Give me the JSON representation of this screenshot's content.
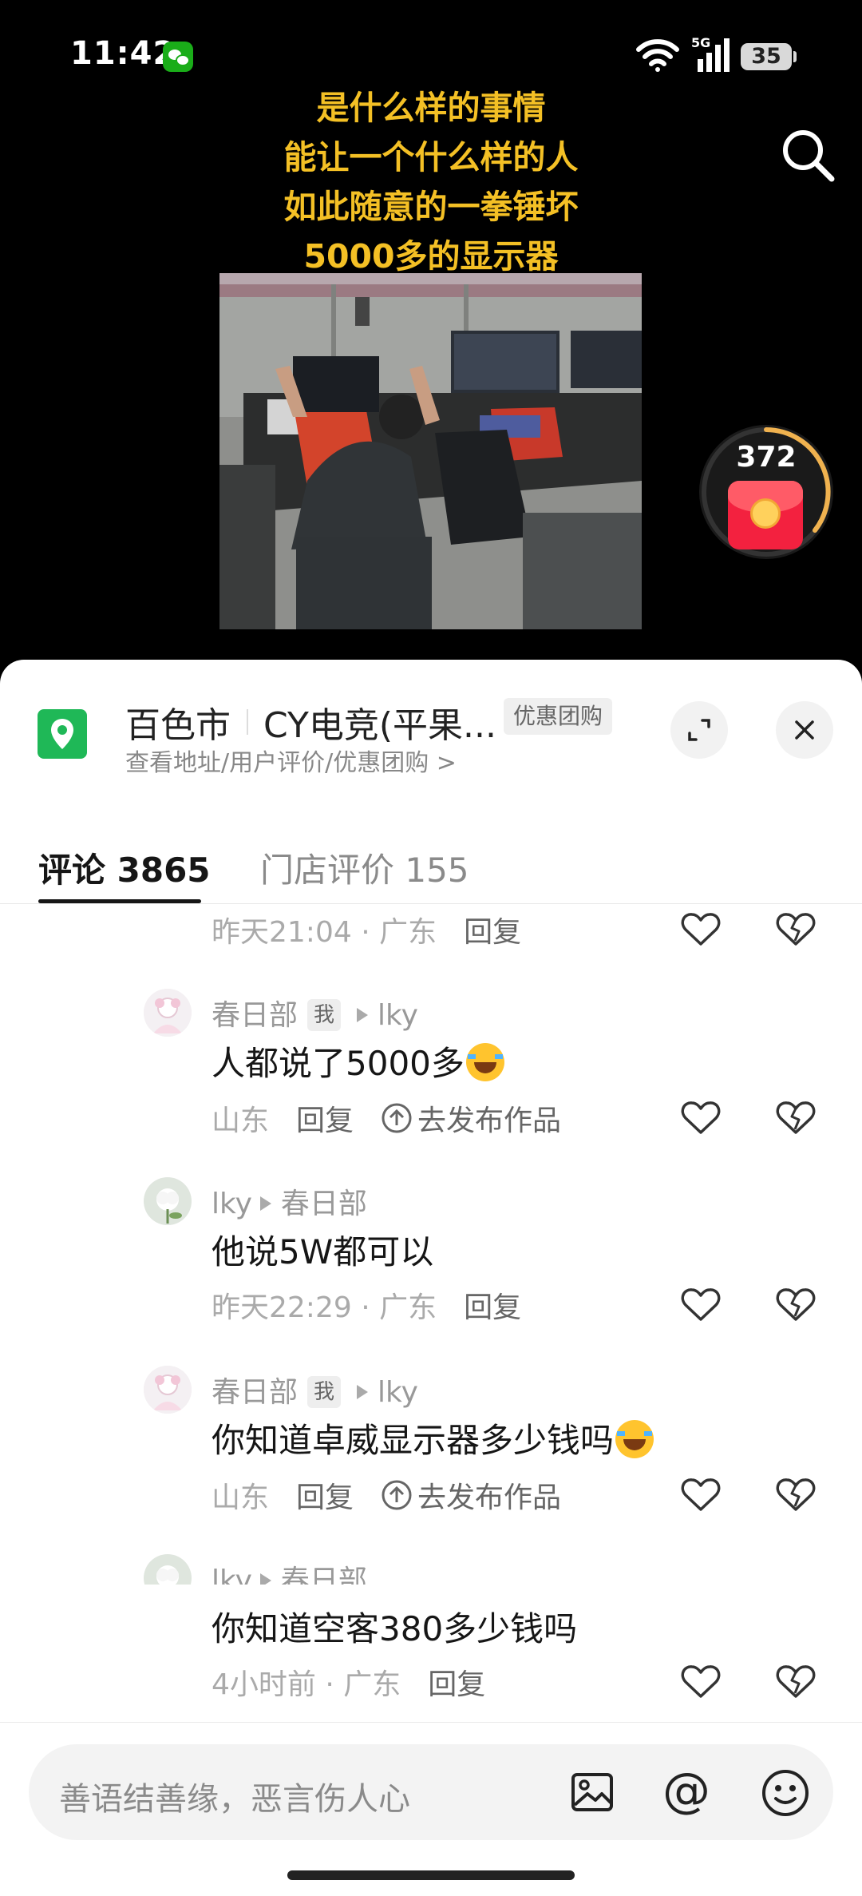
{
  "status_bar": {
    "time": "11:42",
    "network": "5G",
    "battery": "35"
  },
  "video": {
    "caption_lines": [
      "是什么样的事情",
      "能让一个什么样的人",
      "如此随意的一拳锤坏",
      "5000多的显示器"
    ],
    "red_packet_count": "372"
  },
  "location": {
    "city": "百色市",
    "store": "CY电竞(平果...",
    "badge": "优惠团购",
    "subtitle": "查看地址/用户评价/优惠团购 >"
  },
  "tabs": [
    {
      "label": "评论 3865",
      "active": true
    },
    {
      "label": "门店评价 155",
      "active": false
    }
  ],
  "comments": [
    {
      "meta": "昨天21:04 · 广东",
      "reply_label": "回复"
    },
    {
      "user": "春日部",
      "me_badge": "我",
      "reply_to": "lky",
      "text": "人都说了5000多",
      "emoji": "laugh-cry",
      "meta": "山东",
      "reply_label": "回复",
      "publish_label": "去发布作品"
    },
    {
      "user": "lky",
      "reply_to": "春日部",
      "text": "他说5W都可以",
      "meta": "昨天22:29 · 广东",
      "reply_label": "回复"
    },
    {
      "user": "春日部",
      "me_badge": "我",
      "reply_to": "lky",
      "text": "你知道卓威显示器多少钱吗",
      "emoji": "laugh-cry",
      "meta": "山东",
      "reply_label": "回复",
      "publish_label": "去发布作品"
    },
    {
      "user": "lky",
      "reply_to": "春日部",
      "text": "你知道空客380多少钱吗",
      "meta": "4小时前 · 广东",
      "reply_label": "回复"
    }
  ],
  "input": {
    "placeholder": "善语结善缘，恶言伤人心",
    "at_symbol": "@"
  },
  "colors": {
    "caption": "#f4c025",
    "location_icon": "#1fb857",
    "red_packet": "#f3213f"
  }
}
